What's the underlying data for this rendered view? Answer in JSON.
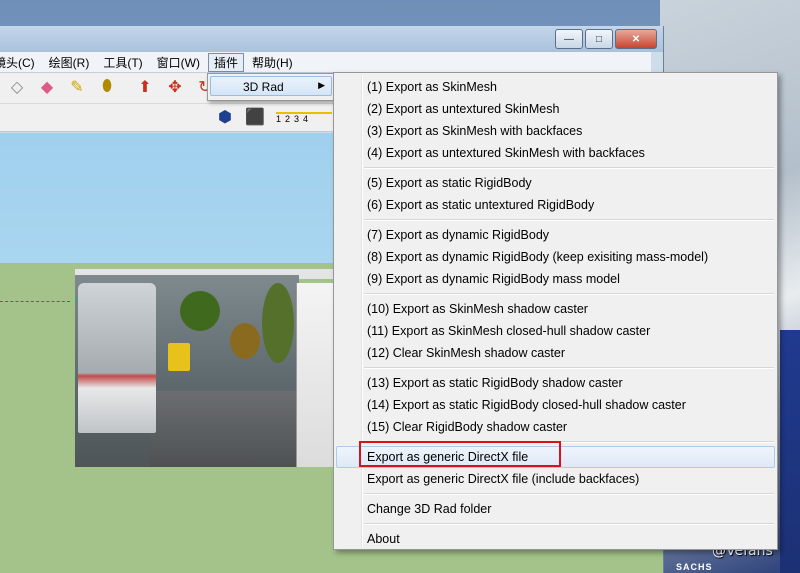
{
  "menubar": {
    "items": [
      "镜头(C)",
      "绘图(R)",
      "工具(T)",
      "窗口(W)",
      "插件",
      "帮助(H)"
    ],
    "active_index": 4
  },
  "window_buttons": {
    "minimize": "—",
    "maximize": "□",
    "close": "✕"
  },
  "toolbar": {
    "scale_labels": [
      "1",
      "2",
      "3",
      "4"
    ]
  },
  "submenu_3drad": {
    "label": "3D Rad",
    "arrow": "▶"
  },
  "dropdown": {
    "groups": [
      [
        "(1) Export as SkinMesh",
        "(2) Export as untextured SkinMesh",
        "(3) Export as SkinMesh with backfaces",
        "(4) Export as untextured SkinMesh with backfaces"
      ],
      [
        "(5) Export as static RigidBody",
        "(6) Export as static untextured RigidBody"
      ],
      [
        "(7) Export as dynamic RigidBody",
        "(8) Export as dynamic RigidBody (keep exisiting mass-model)",
        "(9) Export as dynamic RigidBody mass model"
      ],
      [
        "(10) Export as SkinMesh shadow caster",
        "(11) Export as SkinMesh closed-hull shadow caster",
        "(12) Clear SkinMesh shadow caster"
      ],
      [
        "(13) Export as static RigidBody shadow caster",
        "(14) Export as static RigidBody closed-hull shadow caster",
        "(15) Clear RigidBody shadow caster"
      ],
      [
        "Export as generic DirectX file",
        "Export as generic DirectX file (include backfaces)"
      ],
      [
        "Change 3D Rad folder"
      ],
      [
        "About"
      ]
    ],
    "hovered_item": "Export as generic DirectX file"
  },
  "watermark": "@Vefans",
  "background_brand": "SACHS"
}
